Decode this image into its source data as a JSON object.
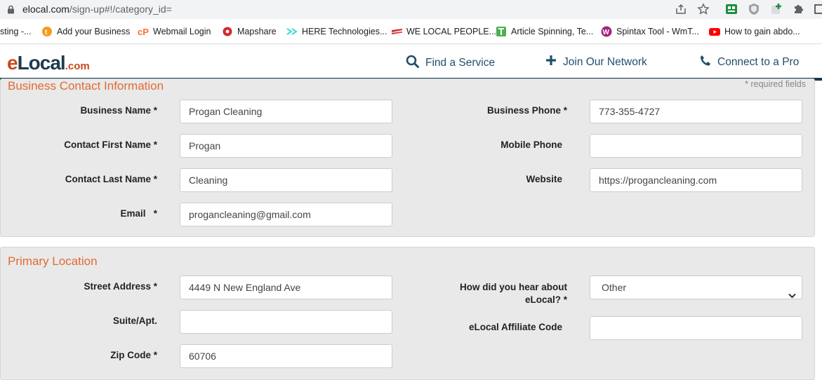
{
  "browser": {
    "url_host": "elocal.com",
    "url_path": "/sign-up#!/category_id="
  },
  "bookmarks": [
    {
      "label": "sting -...",
      "color": "#9e9e9e"
    },
    {
      "label": "Add your Business",
      "color": "#f29c1f"
    },
    {
      "label": "Webmail Login",
      "color": "#ff6c2c"
    },
    {
      "label": "Mapshare",
      "color": "#d4262d"
    },
    {
      "label": "HERE Technologies...",
      "color": "#48dad0"
    },
    {
      "label": "WE LOCAL PEOPLE...",
      "color": "#d42a2a"
    },
    {
      "label": "Article Spinning, Te...",
      "color": "#4caf50"
    },
    {
      "label": "Spintax Tool - WmT...",
      "color": "#a3237a"
    },
    {
      "label": "How to gain abdo...",
      "color": "#ff0000"
    }
  ],
  "site": {
    "logo_e": "e",
    "logo_local": "Local",
    "logo_com": ".com",
    "nav": {
      "find_service": "Find a Service",
      "join_network": "Join Our Network",
      "connect_pro": "Connect to a Pro"
    }
  },
  "business_contact": {
    "title": "Business Contact Information",
    "required_note": "* required fields",
    "business_name_label": "Business Name *",
    "business_name_value": "Progan Cleaning",
    "first_name_label": "Contact First Name *",
    "first_name_value": "Progan",
    "last_name_label": "Contact Last Name *",
    "last_name_value": "Cleaning",
    "email_label": "Email   *",
    "email_value": "progancleaning@gmail.com",
    "business_phone_label": "Business Phone *",
    "business_phone_value": "773-355-4727",
    "mobile_phone_label": "Mobile Phone",
    "mobile_phone_value": "",
    "website_label": "Website",
    "website_value": "https://progancleaning.com"
  },
  "primary_location": {
    "title": "Primary Location",
    "street_label": "Street Address *",
    "street_value": "4449 N New England Ave",
    "suite_label": "Suite/Apt.",
    "suite_value": "",
    "zip_label": "Zip Code *",
    "zip_value": "60706",
    "hear_label": "How did you hear about eLocal? *",
    "hear_selected": "Other",
    "affiliate_label": "eLocal Affiliate Code",
    "affiliate_value": ""
  }
}
